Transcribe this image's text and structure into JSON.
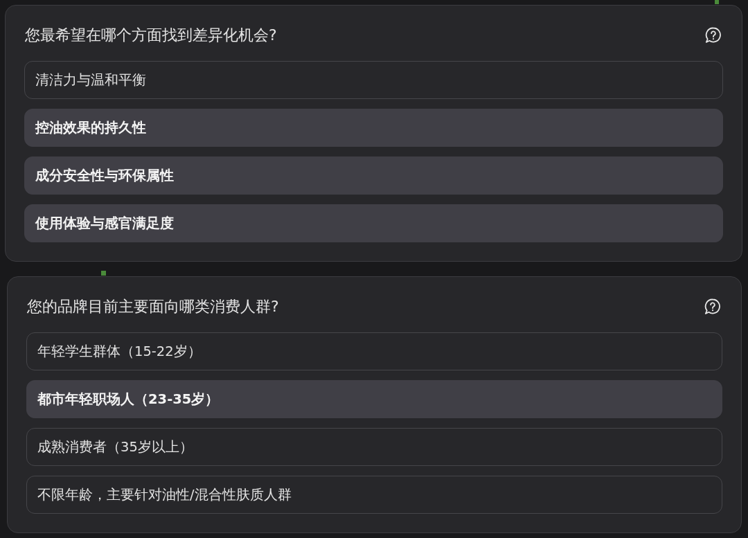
{
  "questions": [
    {
      "title": "您最希望在哪个方面找到差异化机会?",
      "options": [
        {
          "label": "清洁力与温和平衡",
          "selected": false
        },
        {
          "label": "控油效果的持久性",
          "selected": true
        },
        {
          "label": "成分安全性与环保属性",
          "selected": true
        },
        {
          "label": "使用体验与感官满足度",
          "selected": true
        }
      ]
    },
    {
      "title": "您的品牌目前主要面向哪类消费人群?",
      "options": [
        {
          "label": "年轻学生群体（15-22岁）",
          "selected": false
        },
        {
          "label": "都市年轻职场人（23-35岁）",
          "selected": true
        },
        {
          "label": "成熟消费者（35岁以上）",
          "selected": false
        },
        {
          "label": "不限年龄，主要针对油性/混合性肤质人群",
          "selected": false
        }
      ]
    }
  ]
}
